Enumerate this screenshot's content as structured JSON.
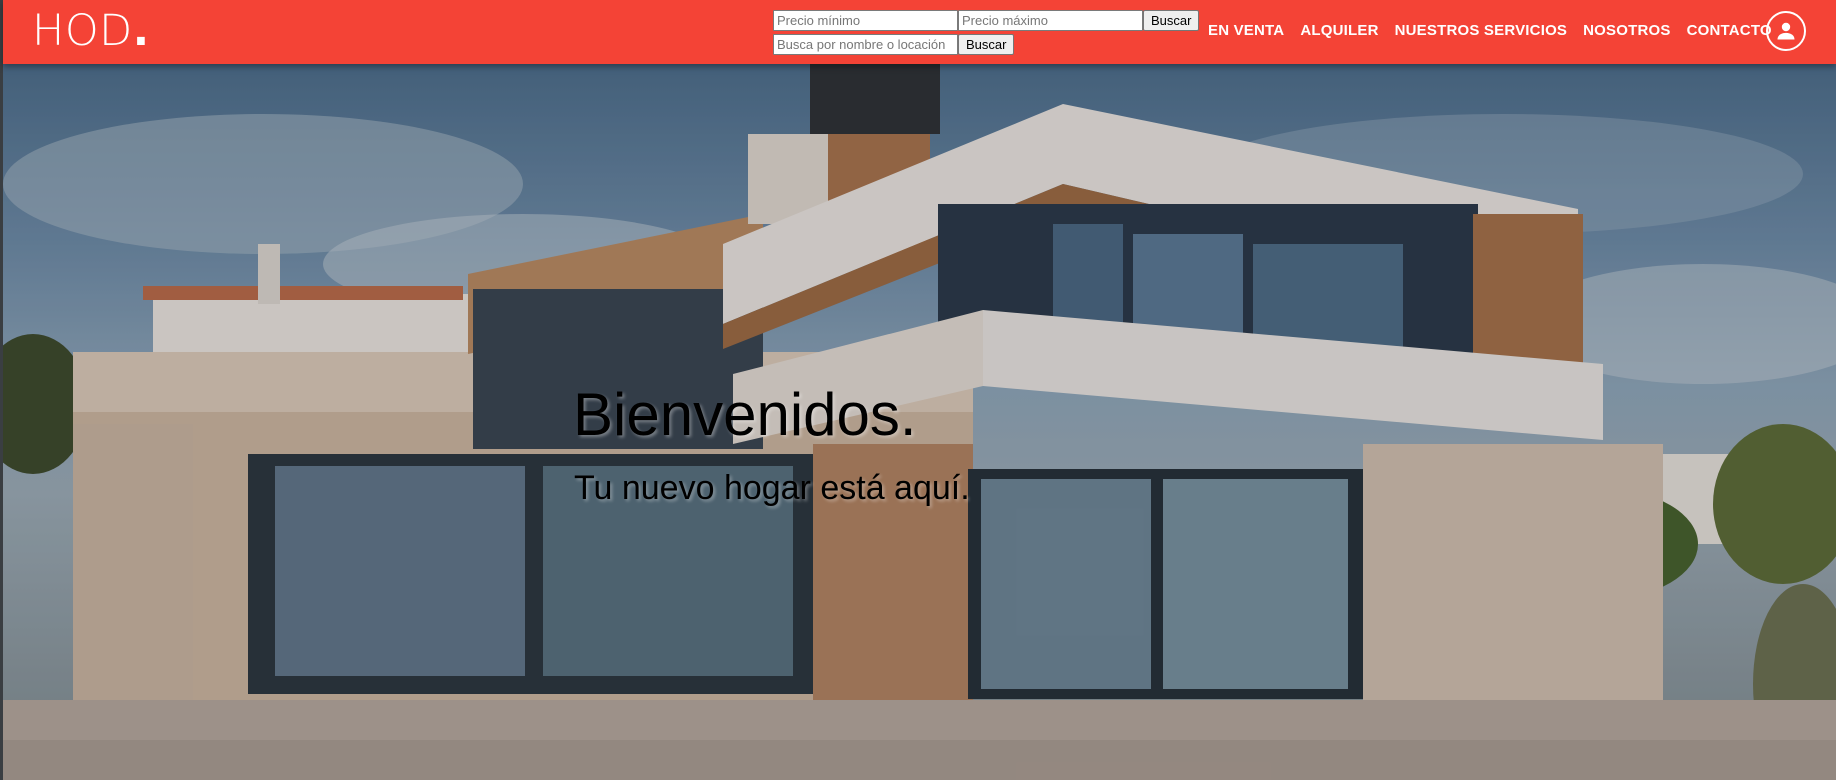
{
  "header": {
    "logo": "HOD",
    "logo_dot": ".",
    "search": {
      "min_price_placeholder": "Precio mínimo",
      "max_price_placeholder": "Precio máximo",
      "price_button": "Buscar",
      "query_placeholder": "Busca por nombre o locación",
      "query_button": "Buscar"
    },
    "nav": [
      {
        "label": "EN VENTA"
      },
      {
        "label": "ALQUILER"
      },
      {
        "label": "NUESTROS SERVICIOS"
      },
      {
        "label": "NOSOTROS"
      },
      {
        "label": "CONTACTO"
      }
    ],
    "user_icon": "account-circle-icon"
  },
  "hero": {
    "title": "Bienvenidos.",
    "subtitle": "Tu nuevo hogar está aquí.",
    "image": "modern-house-photo"
  },
  "colors": {
    "header_bg": "#f44336",
    "header_text": "#ffffff",
    "hero_text": "#000000"
  }
}
